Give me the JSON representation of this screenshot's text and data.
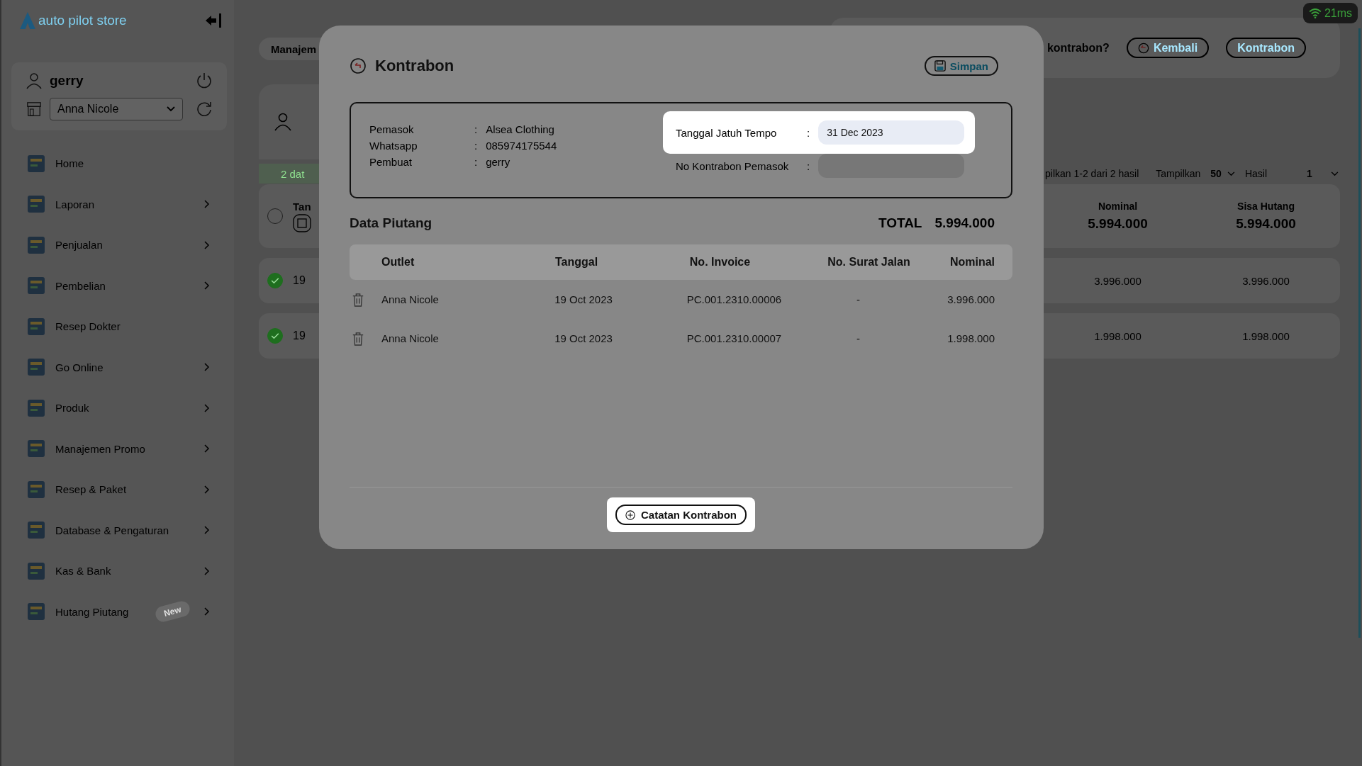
{
  "status_badge": {
    "text": "21ms"
  },
  "sidebar": {
    "logo": "auto pilot store",
    "user": {
      "name": "gerry",
      "outlet": "Anna Nicole"
    },
    "items": [
      {
        "label": "Home",
        "has_submenu": false
      },
      {
        "label": "Laporan",
        "has_submenu": true
      },
      {
        "label": "Penjualan",
        "has_submenu": true
      },
      {
        "label": "Pembelian",
        "has_submenu": true
      },
      {
        "label": "Resep Dokter",
        "has_submenu": false
      },
      {
        "label": "Go Online",
        "has_submenu": true
      },
      {
        "label": "Produk",
        "has_submenu": true
      },
      {
        "label": "Manajemen Promo",
        "has_submenu": true
      },
      {
        "label": "Resep & Paket",
        "has_submenu": true
      },
      {
        "label": "Database & Pengaturan",
        "has_submenu": true
      },
      {
        "label": "Kas & Bank",
        "has_submenu": true
      },
      {
        "label": "Hutang Piutang",
        "has_submenu": true,
        "badge": "New"
      }
    ]
  },
  "background": {
    "breadcrumb": "Manajem",
    "prompt": "kontrabon?",
    "buttons": [
      {
        "label": "Kembali",
        "kind": "back"
      },
      {
        "label": "Kontrabon",
        "kind": "plain"
      }
    ],
    "banner": "2 dat",
    "pagination": {
      "summary": "pilkan 1-2 dari 2 hasil",
      "show_label": "Tampilkan",
      "show_value": "50",
      "page_label": "Hasil",
      "page_value": "1"
    },
    "header_row": {
      "checked": false,
      "label": "Tan",
      "totals": [
        {
          "label": "Nominal",
          "value": "5.994.000"
        },
        {
          "label": "Sisa Hutang",
          "value": "5.994.000"
        }
      ]
    },
    "rows": [
      {
        "checked": true,
        "date": "19",
        "nominal": "3.996.000",
        "remaining": "3.996.000"
      },
      {
        "checked": true,
        "date": "19",
        "nominal": "1.998.000",
        "remaining": "1.998.000"
      }
    ]
  },
  "modal": {
    "title": "Kontrabon",
    "save_button": "Simpan",
    "info": [
      {
        "label": "Pemasok",
        "separator": ":",
        "value": "Alsea Clothing"
      },
      {
        "label": "Whatsapp",
        "separator": ":",
        "value": "085974175544"
      },
      {
        "label": "Pembuat",
        "separator": ":",
        "value": "gerry"
      }
    ],
    "fields": [
      {
        "label": "Tanggal Jatuh Tempo",
        "separator": ":",
        "value": "31 Dec 2023",
        "highlighted": true
      },
      {
        "label": "No Kontrabon Pemasok",
        "separator": ":",
        "highlighted": false
      }
    ],
    "section_title": "Data Piutang",
    "total_label": "TOTAL",
    "total": "5.994.000",
    "columns": [
      "Outlet",
      "Tanggal",
      "No. Invoice",
      "No. Surat Jalan",
      "Nominal"
    ],
    "rows": [
      {
        "outlet": "Anna Nicole",
        "date": "19 Oct 2023",
        "invoice": "PC.001.2310.00006",
        "delivery_note": "-",
        "nominal": "3.996.000"
      },
      {
        "outlet": "Anna Nicole",
        "date": "19 Oct 2023",
        "invoice": "PC.001.2310.00007",
        "delivery_note": "-",
        "nominal": "1.998.000"
      }
    ],
    "note_button": {
      "label": "Catatan Kontrabon",
      "highlighted": true
    }
  }
}
